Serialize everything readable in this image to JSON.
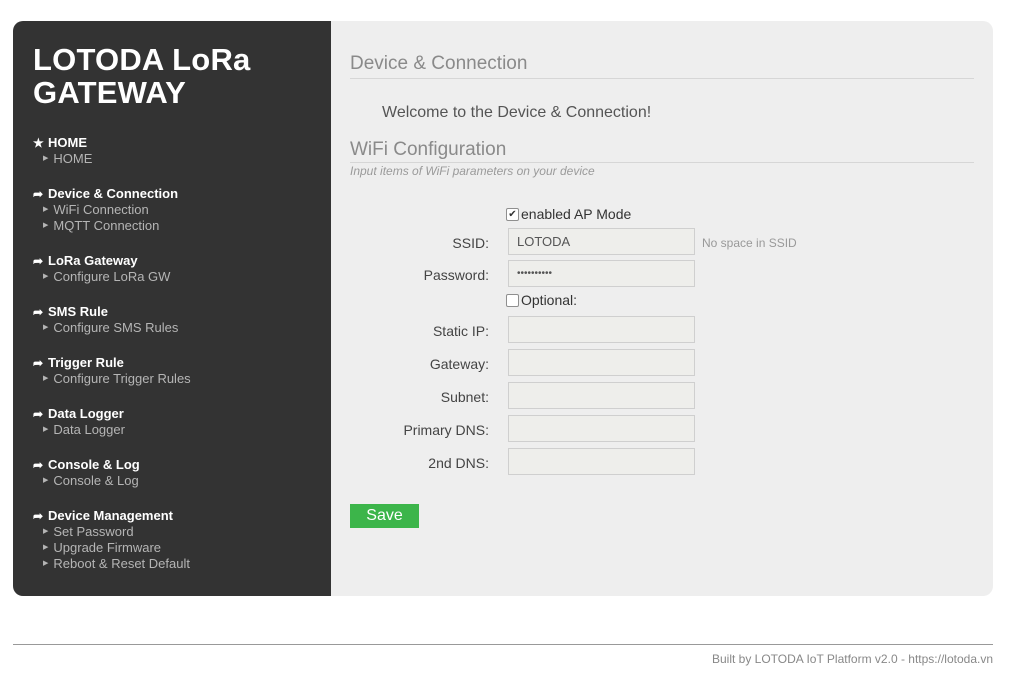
{
  "brand": {
    "line1": "LOTODA LoRa",
    "line2": "GATEWAY"
  },
  "nav": [
    {
      "icon": "star-icon",
      "glyph": "★",
      "label": "HOME",
      "subs": [
        "HOME"
      ]
    },
    {
      "icon": "arrow-right-icon",
      "glyph": "➦",
      "label": "Device & Connection",
      "subs": [
        "WiFi Connection",
        "MQTT Connection"
      ]
    },
    {
      "icon": "arrow-right-icon",
      "glyph": "➦",
      "label": "LoRa Gateway",
      "subs": [
        "Configure LoRa GW"
      ]
    },
    {
      "icon": "arrow-right-icon",
      "glyph": "➦",
      "label": "SMS Rule",
      "subs": [
        "Configure SMS Rules"
      ]
    },
    {
      "icon": "arrow-right-icon",
      "glyph": "➦",
      "label": "Trigger Rule",
      "subs": [
        "Configure Trigger Rules"
      ]
    },
    {
      "icon": "arrow-right-icon",
      "glyph": "➦",
      "label": "Data Logger",
      "subs": [
        "Data Logger"
      ]
    },
    {
      "icon": "arrow-right-icon",
      "glyph": "➦",
      "label": "Console & Log",
      "subs": [
        "Console & Log"
      ]
    },
    {
      "icon": "arrow-right-icon",
      "glyph": "➦",
      "label": "Device Management",
      "subs": [
        "Set Password",
        "Upgrade Firmware",
        "Reboot & Reset Default"
      ]
    }
  ],
  "main": {
    "title": "Device & Connection",
    "welcome": "Welcome to the Device & Connection!",
    "section_title": "WiFi Configuration",
    "section_desc": "Input items of WiFi parameters on your device"
  },
  "form": {
    "ap_mode": {
      "label": "enabled AP Mode",
      "checked": true
    },
    "ssid": {
      "label": "SSID:",
      "value": "LOTODA",
      "hint": "No space in SSID"
    },
    "password": {
      "label": "Password:",
      "value": "••••••••••"
    },
    "optional": {
      "label": "Optional:",
      "checked": false
    },
    "static_ip": {
      "label": "Static IP:",
      "value": ""
    },
    "gateway": {
      "label": "Gateway:",
      "value": ""
    },
    "subnet": {
      "label": "Subnet:",
      "value": ""
    },
    "primary_dns": {
      "label": "Primary DNS:",
      "value": ""
    },
    "second_dns": {
      "label": "2nd DNS:",
      "value": ""
    },
    "save_label": "Save"
  },
  "footer": "Built by LOTODA IoT Platform v2.0 - https://lotoda.vn",
  "colors": {
    "sidebar": "#333333",
    "main_bg": "#eeeeee",
    "save_button": "#3cb54a"
  }
}
